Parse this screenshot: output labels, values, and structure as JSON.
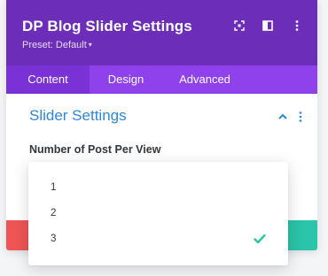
{
  "header": {
    "title": "DP Blog Slider Settings",
    "preset_label": "Preset: Default",
    "preset_caret": "▾",
    "icons": [
      "expand-icon",
      "split-view-icon",
      "kebab-menu-icon"
    ]
  },
  "tabs": [
    {
      "label": "Content",
      "active": true
    },
    {
      "label": "Design",
      "active": false
    },
    {
      "label": "Advanced",
      "active": false
    }
  ],
  "section": {
    "title": "Slider Settings",
    "icons": [
      "chevron-up-icon",
      "more-vertical-icon"
    ]
  },
  "field": {
    "label": "Number of Post Per View",
    "options": [
      "1",
      "2",
      "3"
    ],
    "selected": "3"
  },
  "colors": {
    "header": "#6c2eb9",
    "tabs": "#8f42ec",
    "active_tab": "#7a31d6",
    "section_title": "#2b87da",
    "cancel": "#ef5555",
    "save": "#29c4a9",
    "check": "#29c4a9"
  }
}
